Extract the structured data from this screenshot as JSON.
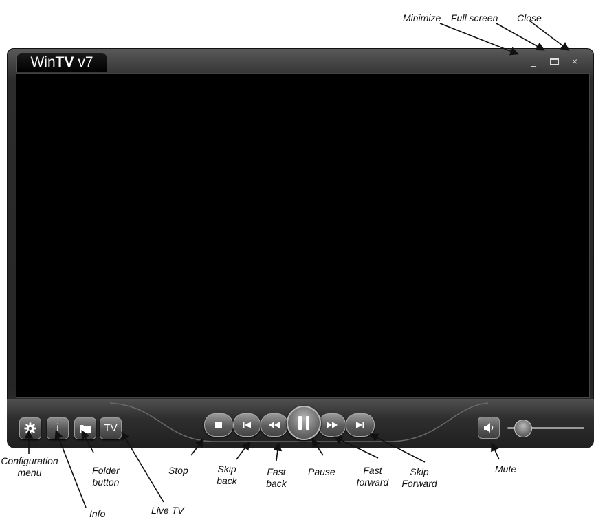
{
  "window": {
    "title_prefix": "Win",
    "title_bold": "TV",
    "title_suffix": " v7",
    "controls": {
      "minimize": "_",
      "close": "×"
    }
  },
  "toolbar_left": {
    "info_glyph": "i",
    "tv_label": "TV"
  },
  "icons": {
    "config": "gear-icon",
    "info": "info-icon",
    "folder": "folder-icon",
    "stop": "stop-icon",
    "skip_back": "skip-back-icon",
    "fast_back": "rewind-icon",
    "pause": "pause-icon",
    "fast_forward": "fast-forward-icon",
    "skip_forward": "skip-forward-icon",
    "mute": "speaker-icon"
  },
  "annotations": {
    "minimize": "Minimize",
    "full_screen": "Full screen",
    "close": "Close",
    "config_line1": "Configuration",
    "config_line2": "menu",
    "info": "Info",
    "folder_line1": "Folder",
    "folder_line2": "button",
    "live_tv": "Live TV",
    "stop": "Stop",
    "skip_back_line1": "Skip",
    "skip_back_line2": "back",
    "fast_back_line1": "Fast",
    "fast_back_line2": "back",
    "pause": "Pause",
    "fast_forward_line1": "Fast",
    "fast_forward_line2": "forward",
    "skip_forward_line1": "Skip",
    "skip_forward_line2": "Forward",
    "mute": "Mute"
  },
  "colors": {
    "window_dark": "#262626",
    "video_bg": "#000000",
    "button_light": "#8a8a8a"
  }
}
